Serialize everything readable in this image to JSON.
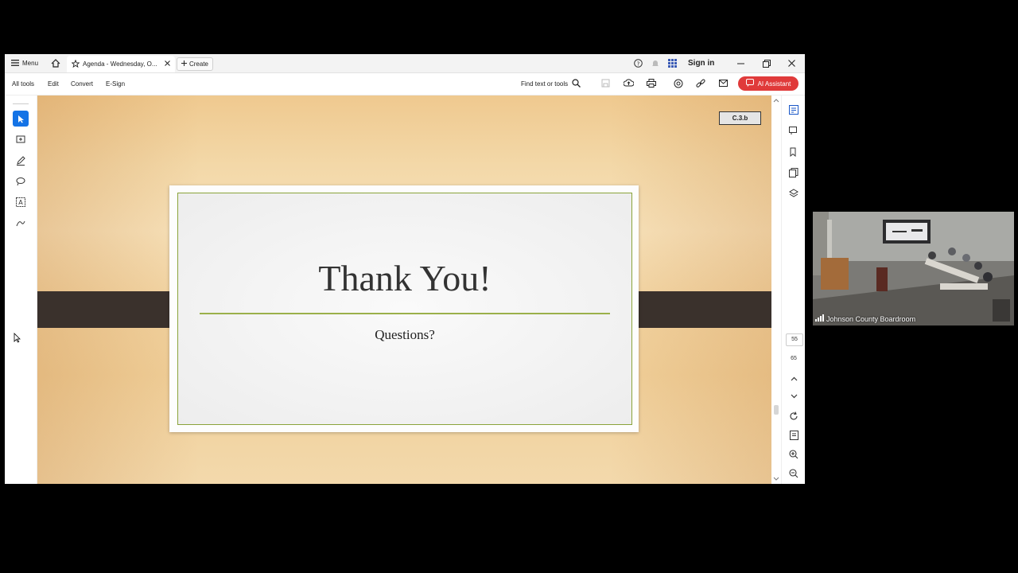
{
  "titlebar": {
    "menu_label": "Menu",
    "tab_title": "Agenda - Wednesday, O...",
    "create_label": "Create",
    "sign_in": "Sign in"
  },
  "toolbar": {
    "items": [
      "All tools",
      "Edit",
      "Convert",
      "E-Sign"
    ],
    "find_label": "Find text or tools",
    "ai_label": "AI Assistant"
  },
  "document": {
    "page_label": "C.3.b",
    "slide_title": "Thank You!",
    "slide_subtitle": "Questions?"
  },
  "page_nav": {
    "current_page": "55",
    "total_pages": "65"
  },
  "video": {
    "caption": "Johnson County Boardroom"
  },
  "colors": {
    "ai_button": "#e03a3a",
    "active_tool": "#1473e6",
    "slide_accent": "#8aa33a",
    "band": "#3a312c"
  }
}
